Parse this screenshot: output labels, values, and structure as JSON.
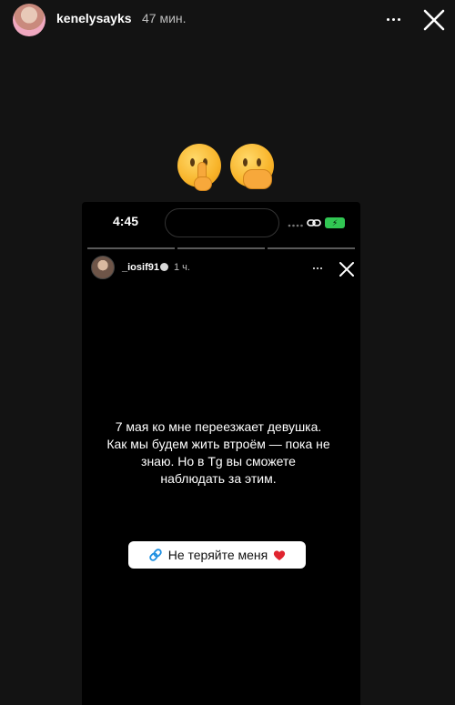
{
  "header": {
    "username": "kenelysayks",
    "timestamp": "47 мин.",
    "more_icon": "more-horizontal-icon",
    "close_icon": "close-icon"
  },
  "emojis": [
    "shushing-face-emoji",
    "face-with-hand-over-mouth-emoji"
  ],
  "screenshot": {
    "status_bar": {
      "time": "4:45",
      "battery": "⚡",
      "battery_color": "#31c653"
    },
    "story_header": {
      "username": "_iosif91",
      "time": "1 ч."
    },
    "message": {
      "line1": "7 мая ко мне переезжает девушка.",
      "line2": "Как мы будем жить втроём — пока не",
      "line3": "знаю. Но в Тg вы сможете",
      "line4": "наблюдать за этим."
    },
    "link_sticker": {
      "label": "Не теряйте меня",
      "icon": "link-icon",
      "emoji": "red-heart-emoji",
      "accent": "#1d8fe1"
    }
  }
}
